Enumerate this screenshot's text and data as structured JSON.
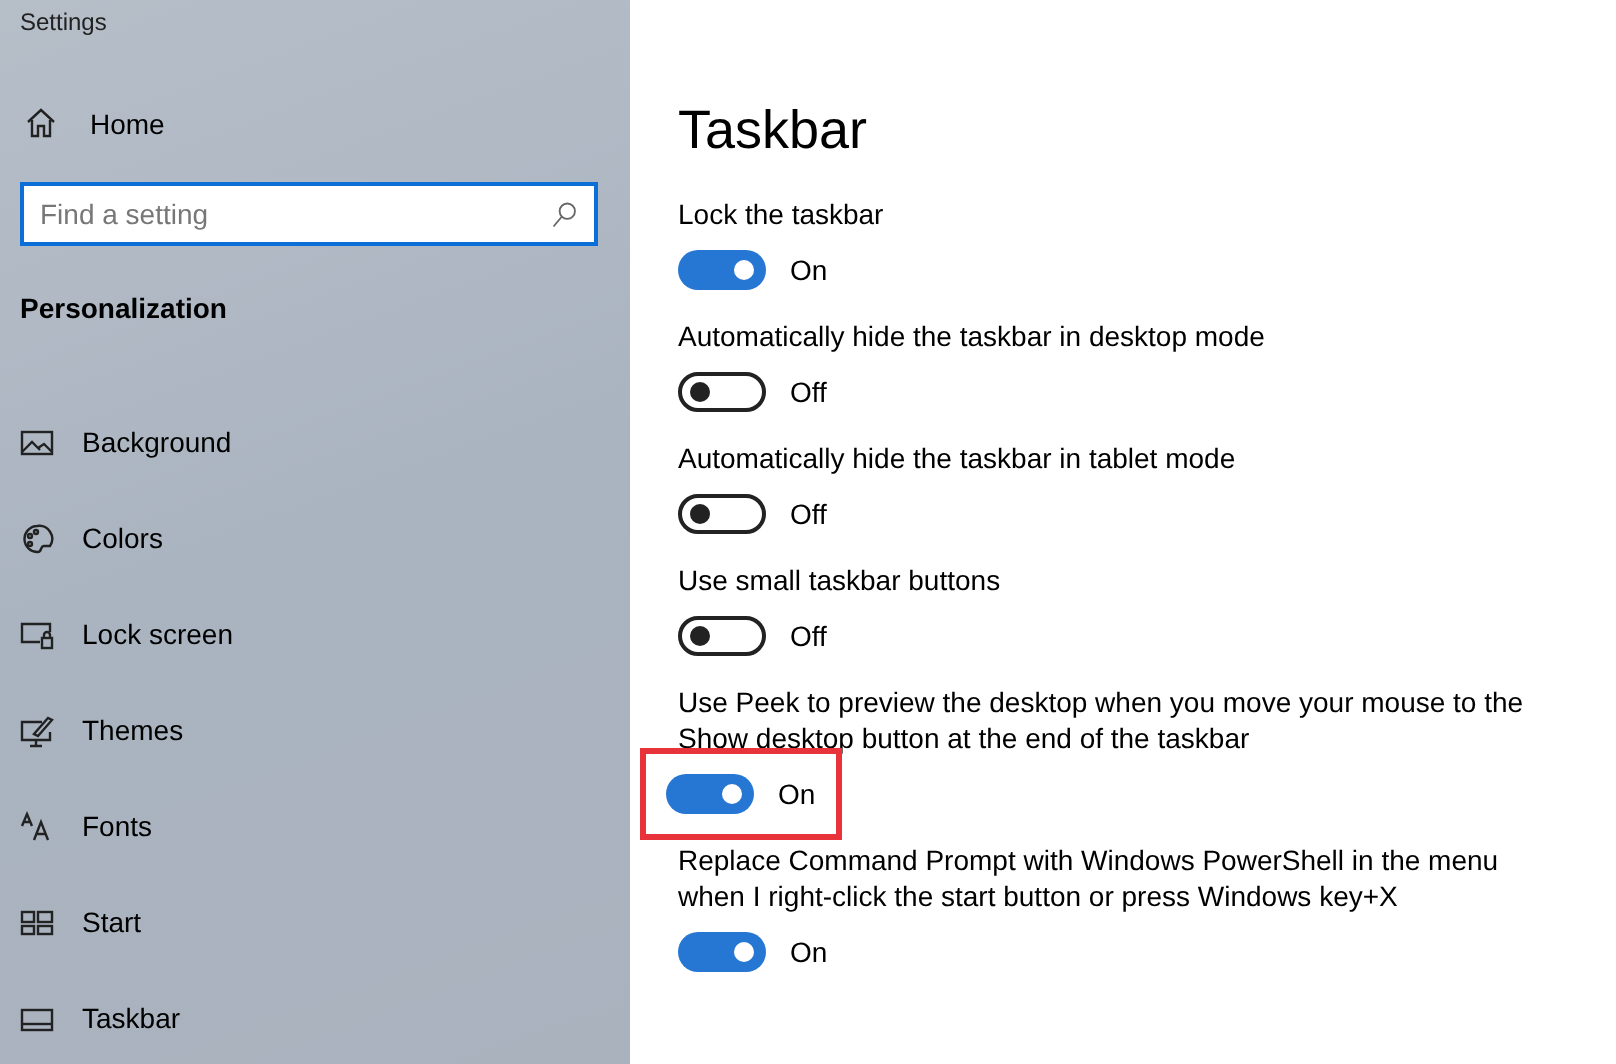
{
  "window": {
    "title": "Settings"
  },
  "sidebar": {
    "home": {
      "label": "Home",
      "kind": "home"
    },
    "search": {
      "placeholder": "Find a setting",
      "focused": true
    },
    "section": "Personalization",
    "items": [
      {
        "label": "Background",
        "kind": "picture"
      },
      {
        "label": "Colors",
        "kind": "palette"
      },
      {
        "label": "Lock screen",
        "kind": "lock-screen"
      },
      {
        "label": "Themes",
        "kind": "themes"
      },
      {
        "label": "Fonts",
        "kind": "fonts"
      },
      {
        "label": "Start",
        "kind": "start"
      },
      {
        "label": "Taskbar",
        "kind": "taskbar"
      }
    ]
  },
  "page": {
    "title": "Taskbar",
    "settings": [
      {
        "label": "Lock the taskbar",
        "on": true,
        "state": "On",
        "highlighted": false
      },
      {
        "label": "Automatically hide the taskbar in desktop mode",
        "on": false,
        "state": "Off",
        "highlighted": false
      },
      {
        "label": "Automatically hide the taskbar in tablet mode",
        "on": false,
        "state": "Off",
        "highlighted": false
      },
      {
        "label": "Use small taskbar buttons",
        "on": false,
        "state": "Off",
        "highlighted": false
      },
      {
        "label": "Use Peek to preview the desktop when you move your mouse to the Show desktop button at the end of the taskbar",
        "on": true,
        "state": "On",
        "highlighted": true
      },
      {
        "label": "Replace Command Prompt with Windows PowerShell in the menu when I right-click the start button or press Windows key+X",
        "on": true,
        "state": "On",
        "highlighted": false
      }
    ]
  }
}
